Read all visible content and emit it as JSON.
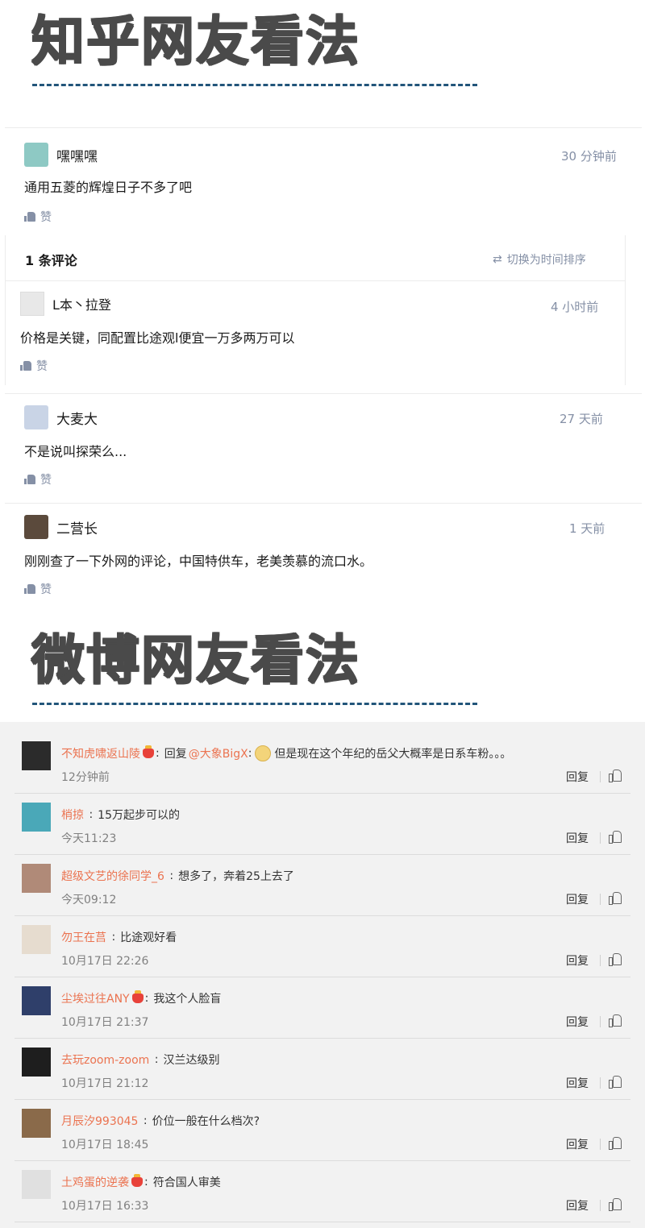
{
  "zhihu": {
    "section_title": "知乎网友看法",
    "like_label": "赞",
    "comments": [
      {
        "name": "嘿嘿嘿",
        "time": "30 分钟前",
        "text": "通用五菱的辉煌日子不多了吧",
        "avatar_color": "#8ec9c4"
      },
      {
        "name": "大麦大",
        "time": "27 天前",
        "text": "不是说叫探荣么...",
        "avatar_color": "#c9d4e6"
      },
      {
        "name": "二营长",
        "time": "1 天前",
        "text": "刚刚查了一下外网的评论，中国特供车，老美羡慕的流口水。",
        "avatar_color": "#5b4a3c"
      }
    ],
    "sub": {
      "count_label": "1 条评论",
      "sort_label": "切换为时间排序",
      "reply": {
        "name": "L本丶拉登",
        "time": "4 小时前",
        "text": "价格是关键，同配置比途观l便宜一万多两万可以",
        "avatar_color": "#e8e8e8"
      }
    }
  },
  "weibo": {
    "section_title": "微博网友看法",
    "reply_label": "回复",
    "comments": [
      {
        "name": "不知虎啸返山陵",
        "vip": true,
        "text": "回复",
        "at": "@大象BigX",
        "after": "但是现在这个年纪的岳父大概率是日系车粉。。。",
        "time": "12分钟前",
        "avatar_color": "#2b2b2b"
      },
      {
        "name": "梢掠",
        "vip": false,
        "text": "15万起步可以的",
        "time": "今天11:23",
        "avatar_color": "#4aa8b8"
      },
      {
        "name": "超级文艺的徐同学_6",
        "vip": false,
        "text": "想多了，奔着25上去了",
        "time": "今天09:12",
        "avatar_color": "#b08a78"
      },
      {
        "name": "勿王在莒",
        "vip": false,
        "text": "比途观好看",
        "time": "10月17日 22:26",
        "avatar_color": "#e6dccf"
      },
      {
        "name": "尘埃过往ANY",
        "vip": true,
        "text": "我这个人脸盲",
        "time": "10月17日 21:37",
        "avatar_color": "#2f3f6a"
      },
      {
        "name": "去玩zoom-zoom",
        "vip": false,
        "text": "汉兰达级别",
        "time": "10月17日 21:12",
        "avatar_color": "#1e1e1e"
      },
      {
        "name": "月辰汐993045",
        "vip": false,
        "text": "价位一般在什么档次?",
        "time": "10月17日 18:45",
        "avatar_color": "#8a6a4a"
      },
      {
        "name": "土鸡蛋的逆袭",
        "vip": true,
        "text": "符合国人审美",
        "time": "10月17日 16:33",
        "avatar_color": "#e0e0e0"
      }
    ]
  }
}
